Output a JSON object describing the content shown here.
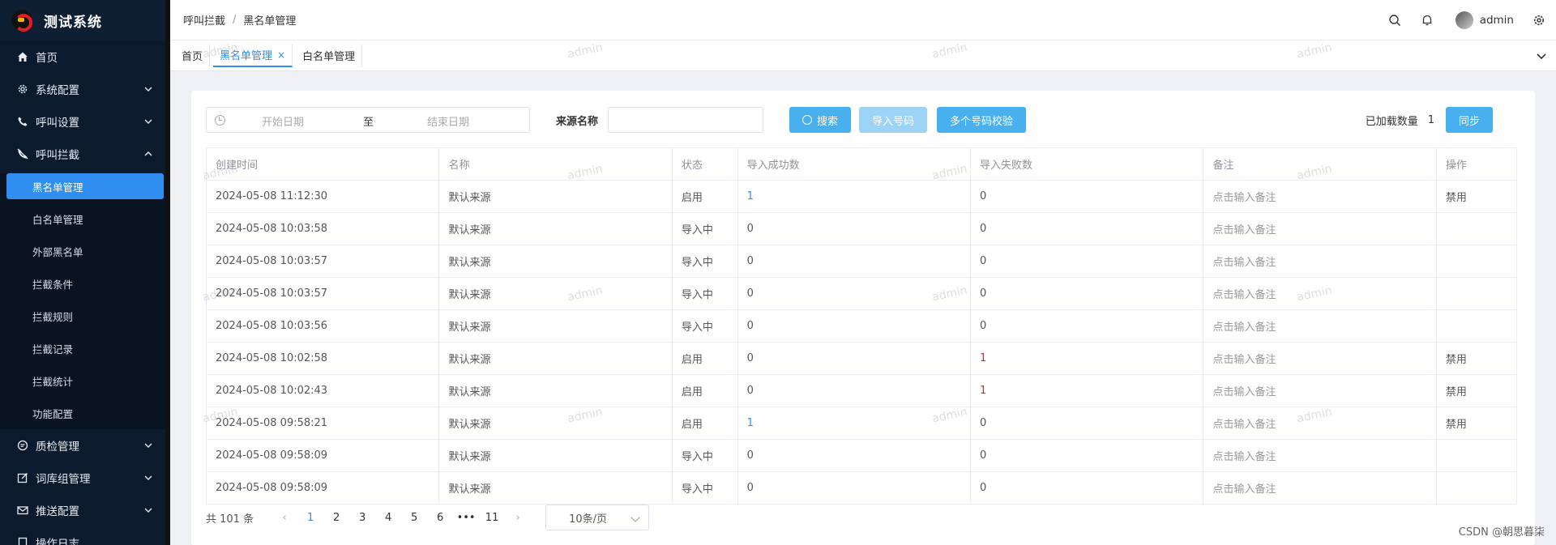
{
  "app": {
    "title": "测试系统"
  },
  "sidebar": {
    "items": [
      {
        "label": "首页",
        "icon": "home-icon"
      },
      {
        "label": "系统配置",
        "icon": "gear-icon"
      },
      {
        "label": "呼叫设置",
        "icon": "phone-icon"
      },
      {
        "label": "呼叫拦截",
        "icon": "phone-block-icon"
      }
    ],
    "subitems": [
      {
        "label": "黑名单管理"
      },
      {
        "label": "白名单管理"
      },
      {
        "label": "外部黑名单"
      },
      {
        "label": "拦截条件"
      },
      {
        "label": "拦截规则"
      },
      {
        "label": "拦截记录"
      },
      {
        "label": "拦截统计"
      },
      {
        "label": "功能配置"
      }
    ],
    "after": [
      {
        "label": "质检管理",
        "icon": "chat-icon"
      },
      {
        "label": "词库组管理",
        "icon": "edit-icon"
      },
      {
        "label": "推送配置",
        "icon": "mail-icon"
      },
      {
        "label": "操作日志",
        "icon": "doc-icon"
      }
    ]
  },
  "header": {
    "breadcrumb": [
      "呼叫拦截",
      "黑名单管理"
    ],
    "sep": "/",
    "username": "admin"
  },
  "tabs": [
    {
      "label": "首页"
    },
    {
      "label": "黑名单管理",
      "close": "×"
    },
    {
      "label": "白名单管理"
    }
  ],
  "filters": {
    "start_placeholder": "开始日期",
    "to": "至",
    "end_placeholder": "结束日期",
    "source_label": "来源名称",
    "search_btn": "搜索",
    "import_btn": "导入号码",
    "multi_btn": "多个号码校验",
    "loaded_label": "已加载数量",
    "loaded_count": "1",
    "sync_btn": "同步"
  },
  "table": {
    "headers": [
      "创建时间",
      "名称",
      "状态",
      "导入成功数",
      "导入失败数",
      "备注",
      "操作"
    ],
    "rows": [
      [
        "2024-05-08 11:12:30",
        "默认来源",
        "启用",
        "1",
        "0",
        "点击输入备注",
        "禁用"
      ],
      [
        "2024-05-08 10:03:58",
        "默认来源",
        "导入中",
        "0",
        "0",
        "点击输入备注",
        ""
      ],
      [
        "2024-05-08 10:03:57",
        "默认来源",
        "导入中",
        "0",
        "0",
        "点击输入备注",
        ""
      ],
      [
        "2024-05-08 10:03:57",
        "默认来源",
        "导入中",
        "0",
        "0",
        "点击输入备注",
        ""
      ],
      [
        "2024-05-08 10:03:56",
        "默认来源",
        "导入中",
        "0",
        "0",
        "点击输入备注",
        ""
      ],
      [
        "2024-05-08 10:02:58",
        "默认来源",
        "启用",
        "0",
        "1",
        "点击输入备注",
        "禁用"
      ],
      [
        "2024-05-08 10:02:43",
        "默认来源",
        "启用",
        "0",
        "1",
        "点击输入备注",
        "禁用"
      ],
      [
        "2024-05-08 09:58:21",
        "默认来源",
        "启用",
        "1",
        "0",
        "点击输入备注",
        "禁用"
      ],
      [
        "2024-05-08 09:58:09",
        "默认来源",
        "导入中",
        "0",
        "0",
        "点击输入备注",
        ""
      ],
      [
        "2024-05-08 09:58:09",
        "默认来源",
        "导入中",
        "0",
        "0",
        "点击输入备注",
        ""
      ]
    ]
  },
  "pagination": {
    "total": "共 101 条",
    "pages": [
      "1",
      "2",
      "3",
      "4",
      "5",
      "6",
      "•••",
      "11"
    ],
    "current": "1",
    "prev": "‹",
    "next": "›",
    "page_size": "10条/页"
  },
  "watermark": "admin",
  "credit": "CSDN @朝思暮柒",
  "colors": {
    "accent": "#2f8ef0",
    "sidebar_bg": "#0b1a2c",
    "button": "#48b0ef",
    "danger": "#e42020"
  }
}
